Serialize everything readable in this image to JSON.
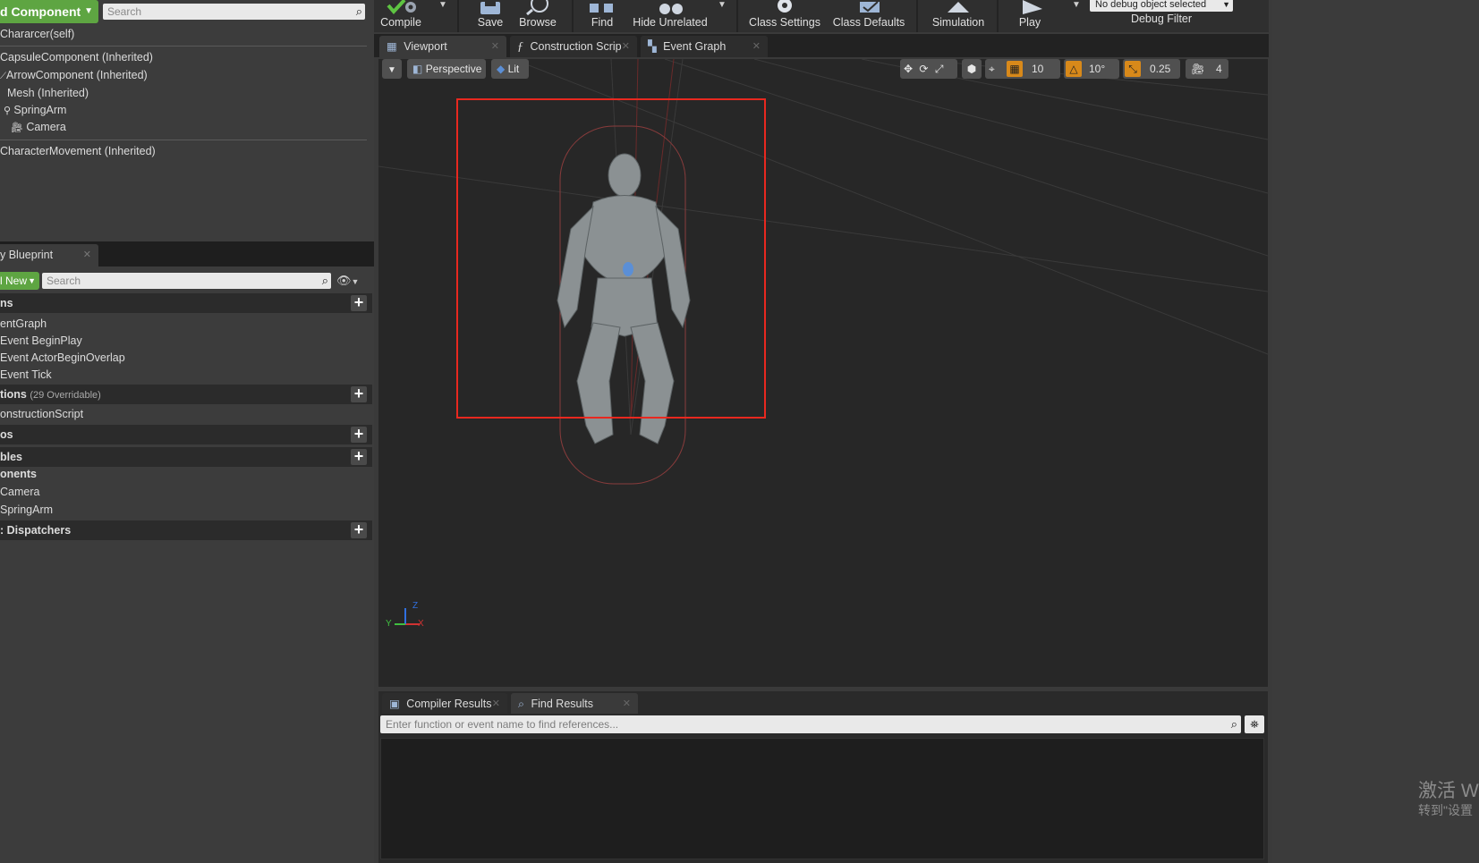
{
  "components_panel": {
    "add_component_label": "d Component",
    "search_placeholder": "Search",
    "self_item": "Chararcer(self)",
    "tree": [
      "CapsuleComponent (Inherited)",
      "ArrowComponent (Inherited)",
      "Mesh (Inherited)",
      "SpringArm",
      "Camera",
      "CharacterMovement (Inherited)"
    ]
  },
  "my_blueprint": {
    "tab_label": "y Blueprint",
    "add_new_label": "l New",
    "search_placeholder": "Search",
    "sections": {
      "graphs": "ns",
      "functions": "tions",
      "functions_sub": "(29 Overridable)",
      "macros": "os",
      "variables": "bles",
      "components": "onents",
      "dispatchers": ": Dispatchers"
    },
    "graph_items": [
      "entGraph",
      "Event BeginPlay",
      "Event ActorBeginOverlap",
      "Event Tick"
    ],
    "function_items": [
      "onstructionScript"
    ],
    "component_items": [
      "Camera",
      "SpringArm"
    ]
  },
  "toolbar": {
    "compile": "Compile",
    "save": "Save",
    "browse": "Browse",
    "find": "Find",
    "hide_unrelated": "Hide Unrelated",
    "class_settings": "Class Settings",
    "class_defaults": "Class Defaults",
    "simulation": "Simulation",
    "play": "Play",
    "debug_select": "No debug object selected",
    "debug_filter": "Debug Filter"
  },
  "editor_tabs": [
    "Viewport",
    "Construction Scrip",
    "Event Graph"
  ],
  "viewport": {
    "perspective": "Perspective",
    "lit": "Lit",
    "grid_snap": "10",
    "rotation_snap": "10°",
    "scale_snap": "0.25",
    "camera_speed": "4",
    "axis_y": "Y",
    "axis_z": "Z",
    "axis_x": "X"
  },
  "results": {
    "tabs": [
      "Compiler Results",
      "Find Results"
    ],
    "find_placeholder": "Enter function or event name to find references..."
  },
  "watermark": {
    "line1": "激活 W",
    "line2": "转到\"设置"
  },
  "colors": {
    "accent_green": "#5ea542",
    "selection_red": "#e8281f",
    "snap_orange": "#d8891a"
  }
}
